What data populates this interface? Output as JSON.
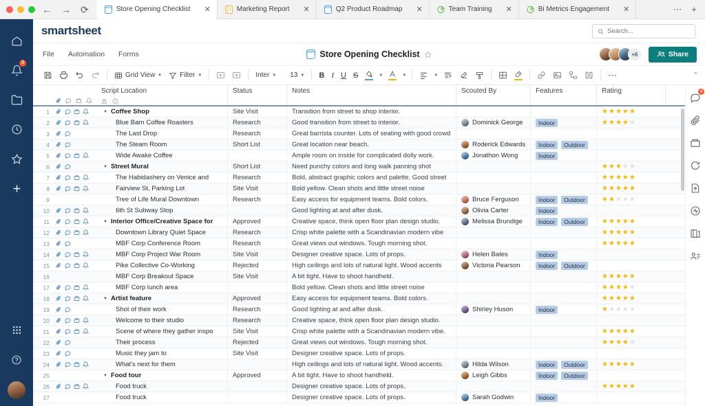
{
  "browser": {
    "nav": {
      "back": "←",
      "forward": "→",
      "reload": "⟳"
    },
    "tabs": [
      {
        "title": "Store Opening Checklist",
        "icon": "sheet-icon",
        "active": true,
        "close": "✕"
      },
      {
        "title": "Marketing Report",
        "icon": "report-icon",
        "active": false,
        "close": "✕"
      },
      {
        "title": "Q2 Product Roadmap",
        "icon": "sheet-icon",
        "active": false,
        "close": "✕"
      },
      {
        "title": "Team Training",
        "icon": "dashboard-icon",
        "active": false,
        "close": "✕"
      },
      {
        "title": "Bi Metrics Engagement",
        "icon": "dashboard-icon",
        "active": false,
        "close": "✕"
      }
    ],
    "overflow": "⋯",
    "new_tab": "+"
  },
  "rail": {
    "items": [
      {
        "name": "home",
        "badge": ""
      },
      {
        "name": "notifications",
        "badge": "3"
      },
      {
        "name": "browse",
        "badge": ""
      },
      {
        "name": "recents",
        "badge": ""
      },
      {
        "name": "favorites",
        "badge": ""
      },
      {
        "name": "create",
        "badge": ""
      }
    ],
    "bottom": [
      {
        "name": "apps-grid"
      },
      {
        "name": "help"
      },
      {
        "name": "user-avatar"
      }
    ]
  },
  "header": {
    "logo": "smartsheet",
    "search_placeholder": "Search...",
    "search_value": ""
  },
  "menubar": {
    "items": [
      "File",
      "Automation",
      "Forms"
    ],
    "sheet_title": "Store Opening Checklist",
    "favorite_icon": "star-icon",
    "collaborators_more": "+6",
    "share_label": "Share"
  },
  "toolbar": {
    "save_icon": "save-icon",
    "print_icon": "print-icon",
    "undo_icon": "undo-icon",
    "redo_icon": "redo-icon",
    "view_label": "Grid View",
    "filter_label": "Filter",
    "outdent_icon": "outdent-icon",
    "indent_icon": "indent-icon",
    "font_family": "Inter",
    "font_size": "13",
    "bold": "B",
    "italic": "I",
    "underline": "U",
    "strikethrough": "S",
    "fill_color_icon": "fill-color-icon",
    "text_color_icon": "text-color-icon",
    "align_icon": "align-left-icon",
    "wrap_icon": "wrap-text-icon",
    "clear_format_icon": "clear-format-icon",
    "format_painter_icon": "format-painter-icon",
    "cell_borders_icon": "cell-borders-icon",
    "highlight_icon": "highlight-icon",
    "link_icon": "link-icon",
    "image_icon": "image-icon",
    "hierarchy_icon": "hierarchy-icon",
    "column_icon": "column-icon",
    "more_icon": "more-icon",
    "collapse_icon": "chevron-up-icon",
    "accent_blue": "#5b9bd5",
    "accent_yellow": "#f2b705"
  },
  "right_rail": {
    "items": [
      {
        "name": "conversations-icon",
        "badge": "3"
      },
      {
        "name": "attachments-icon",
        "badge": ""
      },
      {
        "name": "proofs-icon",
        "badge": ""
      },
      {
        "name": "update-requests-icon",
        "badge": ""
      },
      {
        "name": "publish-icon",
        "badge": ""
      },
      {
        "name": "activity-log-icon",
        "badge": ""
      },
      {
        "name": "summary-icon",
        "badge": ""
      },
      {
        "name": "sharing-icon",
        "badge": ""
      }
    ]
  },
  "grid": {
    "columns": [
      {
        "key": "location",
        "label": "Script Location"
      },
      {
        "key": "status",
        "label": "Status"
      },
      {
        "key": "notes",
        "label": "Notes"
      },
      {
        "key": "scouted_by",
        "label": "Scouted By"
      },
      {
        "key": "features",
        "label": "Features"
      },
      {
        "key": "rating",
        "label": "Rating"
      }
    ],
    "header_icons": [
      "attachment-icon",
      "comment-icon",
      "proof-icon",
      "reminder-icon"
    ],
    "locked_icon": "lock-icon",
    "info_icon": "info-icon",
    "rows": [
      {
        "n": "1",
        "group": true,
        "location": "Coffee Shop",
        "status": "Site Visit",
        "notes": "Transition from street to shop interior.",
        "scouted_by": "",
        "features": [],
        "rating": 5,
        "icons": [
          "attachment",
          "comment",
          "proof",
          "reminder"
        ]
      },
      {
        "n": "2",
        "group": false,
        "location": "Blue Barn Coffee Roasters",
        "status": "Research",
        "notes": "Good transition from street to interior.",
        "scouted_by": "Dominick George",
        "features": [
          "Indoor"
        ],
        "rating": 4,
        "icons": [
          "attachment",
          "comment",
          "proof",
          "reminder"
        ]
      },
      {
        "n": "3",
        "group": false,
        "location": "The Last Drop",
        "status": "Research",
        "notes": "Great barrista counter. Lots of seating with good crowd",
        "scouted_by": "",
        "features": [],
        "rating": 0,
        "icons": [
          "attachment",
          "comment"
        ]
      },
      {
        "n": "4",
        "group": false,
        "location": "The Steam Room",
        "status": "Short List",
        "notes": "Great location near beach.",
        "scouted_by": "Roderick Edwards",
        "features": [
          "Indoor",
          "Outdoor"
        ],
        "rating": 0,
        "icons": [
          "attachment",
          "comment"
        ]
      },
      {
        "n": "5",
        "group": false,
        "location": "Wide Awake Coffee",
        "status": "",
        "notes": "Ample room on inside for complicated dolly work.",
        "scouted_by": "Jonathon Wong",
        "features": [
          "Indoor"
        ],
        "rating": 0,
        "icons": [
          "attachment",
          "comment",
          "proof",
          "reminder"
        ]
      },
      {
        "n": "6",
        "group": true,
        "location": "Street Mural",
        "status": "Short List",
        "notes": "Need punchy colors and long walk panning shot",
        "scouted_by": "",
        "features": [],
        "rating": 3,
        "icons": [
          "attachment",
          "comment"
        ]
      },
      {
        "n": "7",
        "group": false,
        "location": "The Habidashery on Venice and",
        "status": "Research",
        "notes": "Bold, abstract graphic colors and palette. Good street",
        "scouted_by": "",
        "features": [],
        "rating": 5,
        "icons": [
          "attachment",
          "comment",
          "proof",
          "reminder"
        ]
      },
      {
        "n": "8",
        "group": false,
        "location": "Fairview St, Parking Lot",
        "status": "Site Visit",
        "notes": "Bold yellow. Clean shots and little street noise",
        "scouted_by": "",
        "features": [],
        "rating": 5,
        "icons": [
          "attachment",
          "comment",
          "proof",
          "reminder"
        ]
      },
      {
        "n": "9",
        "group": false,
        "location": "Tree of Life Mural Downtown",
        "status": "Research",
        "notes": "Easy access for equipment teams. Bold colors.",
        "scouted_by": "Bruce Ferguson",
        "features": [
          "Indoor",
          "Outdoor"
        ],
        "rating": 2,
        "icons": []
      },
      {
        "n": "10",
        "group": false,
        "location": "6th St Subway Stop",
        "status": "",
        "notes": "Good lighting at and after dusk.",
        "scouted_by": "Olivia Carter",
        "features": [
          "Indoor"
        ],
        "rating": 0,
        "icons": [
          "attachment",
          "comment",
          "proof",
          "reminder"
        ]
      },
      {
        "n": "11",
        "group": true,
        "location": "Interior Office/Creative Space for",
        "status": "Approved",
        "notes": "Creative space, think open floor plan design studio.",
        "scouted_by": "Melissa Brundige",
        "features": [
          "Indoor",
          "Outdoor"
        ],
        "rating": 5,
        "icons": [
          "attachment",
          "comment",
          "proof",
          "reminder"
        ]
      },
      {
        "n": "12",
        "group": false,
        "location": "Downtown Library Quiet Space",
        "status": "Research",
        "notes": "Crisp white palette with a Scandinavian modern vibe",
        "scouted_by": "",
        "features": [],
        "rating": 5,
        "icons": [
          "attachment",
          "comment",
          "proof",
          "reminder"
        ]
      },
      {
        "n": "13",
        "group": false,
        "location": "MBF Corp Conference Room",
        "status": "Research",
        "notes": "Great views out windows. Tough morning shot.",
        "scouted_by": "",
        "features": [],
        "rating": 5,
        "icons": [
          "attachment",
          "comment"
        ]
      },
      {
        "n": "14",
        "group": false,
        "location": "MBF Corp Project War Room",
        "status": "Site Visit",
        "notes": "Designer creative space. Lots of props.",
        "scouted_by": "Helen Bates",
        "features": [
          "Indoor"
        ],
        "rating": 0,
        "icons": [
          "attachment",
          "comment",
          "proof",
          "reminder"
        ]
      },
      {
        "n": "15",
        "group": false,
        "location": "Pike Collective Co-Working",
        "status": "Rejected",
        "notes": "High ceilings and lots of natural light. Wood accents",
        "scouted_by": "Victoria Pearson",
        "features": [
          "Indoor",
          "Outdoor"
        ],
        "rating": 0,
        "icons": [
          "attachment",
          "comment",
          "proof",
          "reminder"
        ]
      },
      {
        "n": "16",
        "group": false,
        "location": "MBF Corp Breakout Space",
        "status": "Site Visit",
        "notes": "A bit tight. Have to shoot handheld.",
        "scouted_by": "",
        "features": [],
        "rating": 5,
        "icons": []
      },
      {
        "n": "17",
        "group": false,
        "location": "MBF Corp lunch area",
        "status": "",
        "notes": "Bold yellow. Clean shots and little street noise",
        "scouted_by": "",
        "features": [],
        "rating": 4,
        "icons": [
          "attachment",
          "comment",
          "proof",
          "reminder"
        ]
      },
      {
        "n": "18",
        "group": true,
        "location": "Artist feature",
        "status": "Approved",
        "notes": "Easy access for equipment teams. Bold colors.",
        "scouted_by": "",
        "features": [],
        "rating": 5,
        "icons": [
          "attachment",
          "comment",
          "proof",
          "reminder"
        ]
      },
      {
        "n": "19",
        "group": false,
        "location": "Shot of their work",
        "status": "Research",
        "notes": "Good lighting at and after dusk.",
        "scouted_by": "Shirley Huson",
        "features": [
          "Indoor"
        ],
        "rating": 1,
        "icons": [
          "attachment",
          "comment"
        ]
      },
      {
        "n": "20",
        "group": false,
        "location": "Welcome to their studio",
        "status": "Research",
        "notes": "Creative space, think open floor plan design studio.",
        "scouted_by": "",
        "features": [],
        "rating": 0,
        "icons": [
          "attachment",
          "comment",
          "proof",
          "reminder"
        ]
      },
      {
        "n": "21",
        "group": false,
        "location": "Scene of where they gather inspo",
        "status": "Site Visit",
        "notes": "Crisp white palette with a Scandinavian modern vibe.",
        "scouted_by": "",
        "features": [],
        "rating": 5,
        "icons": [
          "attachment",
          "comment",
          "proof",
          "reminder"
        ]
      },
      {
        "n": "22",
        "group": false,
        "location": "Their process",
        "status": "Rejected",
        "notes": "Great views out windows. Tough morning shot.",
        "scouted_by": "",
        "features": [],
        "rating": 4,
        "icons": [
          "attachment",
          "comment"
        ]
      },
      {
        "n": "23",
        "group": false,
        "location": "Music they jam to",
        "status": "Site Visit",
        "notes": "Designer creative space. Lots of props.",
        "scouted_by": "",
        "features": [],
        "rating": 0,
        "icons": [
          "attachment",
          "comment"
        ]
      },
      {
        "n": "24",
        "group": false,
        "location": "What's next for them",
        "status": "",
        "notes": "High ceilings and lots of natural light. Wood accents.",
        "scouted_by": "Hilda Wilson",
        "features": [
          "Indoor",
          "Outdoor"
        ],
        "rating": 5,
        "icons": [
          "attachment",
          "comment",
          "proof",
          "reminder"
        ]
      },
      {
        "n": "25",
        "group": true,
        "location": "Food tour",
        "status": "Approved",
        "notes": "A bit tight. Have to shoot handheld.",
        "scouted_by": "Leigh Gibbs",
        "features": [
          "Indoor",
          "Outdoor"
        ],
        "rating": 0,
        "icons": []
      },
      {
        "n": "26",
        "group": false,
        "location": "Food truck",
        "status": "",
        "notes": "Designer creative space. Lots of props.",
        "scouted_by": "",
        "features": [],
        "rating": 5,
        "icons": [
          "attachment",
          "comment",
          "proof",
          "reminder"
        ]
      },
      {
        "n": "27",
        "group": false,
        "location": "Food truck",
        "status": "",
        "notes": "Designer creative space. Lots of props.",
        "scouted_by": "Sarah Godwin",
        "features": [
          "Indoor"
        ],
        "rating": 0,
        "icons": []
      }
    ]
  }
}
